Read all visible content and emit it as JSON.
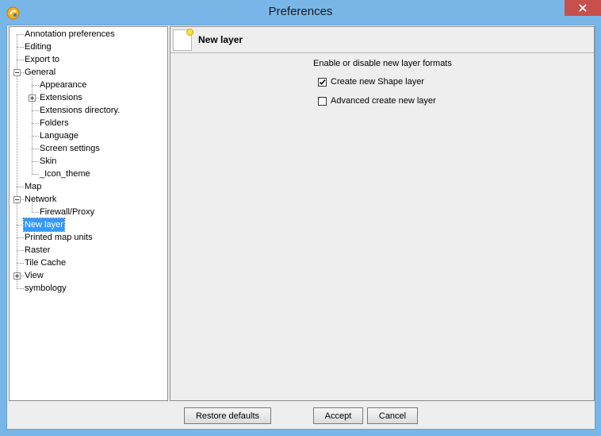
{
  "window": {
    "title": "Preferences",
    "accent_color": "#79b6e8",
    "close_color": "#c7504c"
  },
  "tree": {
    "items": [
      {
        "label": "Annotation preferences",
        "level": 0,
        "expander": "none"
      },
      {
        "label": "Editing",
        "level": 0,
        "expander": "none"
      },
      {
        "label": "Export to",
        "level": 0,
        "expander": "none"
      },
      {
        "label": "General",
        "level": 0,
        "expander": "minus"
      },
      {
        "label": "Appearance",
        "level": 1,
        "expander": "none"
      },
      {
        "label": "Extensions",
        "level": 1,
        "expander": "plus"
      },
      {
        "label": "Extensions directory.",
        "level": 1,
        "expander": "none"
      },
      {
        "label": "Folders",
        "level": 1,
        "expander": "none"
      },
      {
        "label": "Language",
        "level": 1,
        "expander": "none"
      },
      {
        "label": "Screen settings",
        "level": 1,
        "expander": "none"
      },
      {
        "label": "Skin",
        "level": 1,
        "expander": "none"
      },
      {
        "label": "_Icon_theme",
        "level": 1,
        "expander": "none"
      },
      {
        "label": "Map",
        "level": 0,
        "expander": "none"
      },
      {
        "label": "Network",
        "level": 0,
        "expander": "minus"
      },
      {
        "label": "Firewall/Proxy",
        "level": 1,
        "expander": "none"
      },
      {
        "label": "New layer",
        "level": 0,
        "expander": "none",
        "selected": true
      },
      {
        "label": "Printed map units",
        "level": 0,
        "expander": "none"
      },
      {
        "label": "Raster",
        "level": 0,
        "expander": "none"
      },
      {
        "label": "Tile Cache",
        "level": 0,
        "expander": "none"
      },
      {
        "label": "View",
        "level": 0,
        "expander": "plus"
      },
      {
        "label": "symbology",
        "level": 0,
        "expander": "none"
      }
    ]
  },
  "panel": {
    "title": "New layer",
    "group_label": "Enable or disable new layer formats",
    "options": [
      {
        "label": "Create new Shape layer",
        "checked": true
      },
      {
        "label": "Advanced create new layer",
        "checked": false
      }
    ]
  },
  "buttons": {
    "restore": "Restore defaults",
    "accept": "Accept",
    "cancel": "Cancel"
  }
}
